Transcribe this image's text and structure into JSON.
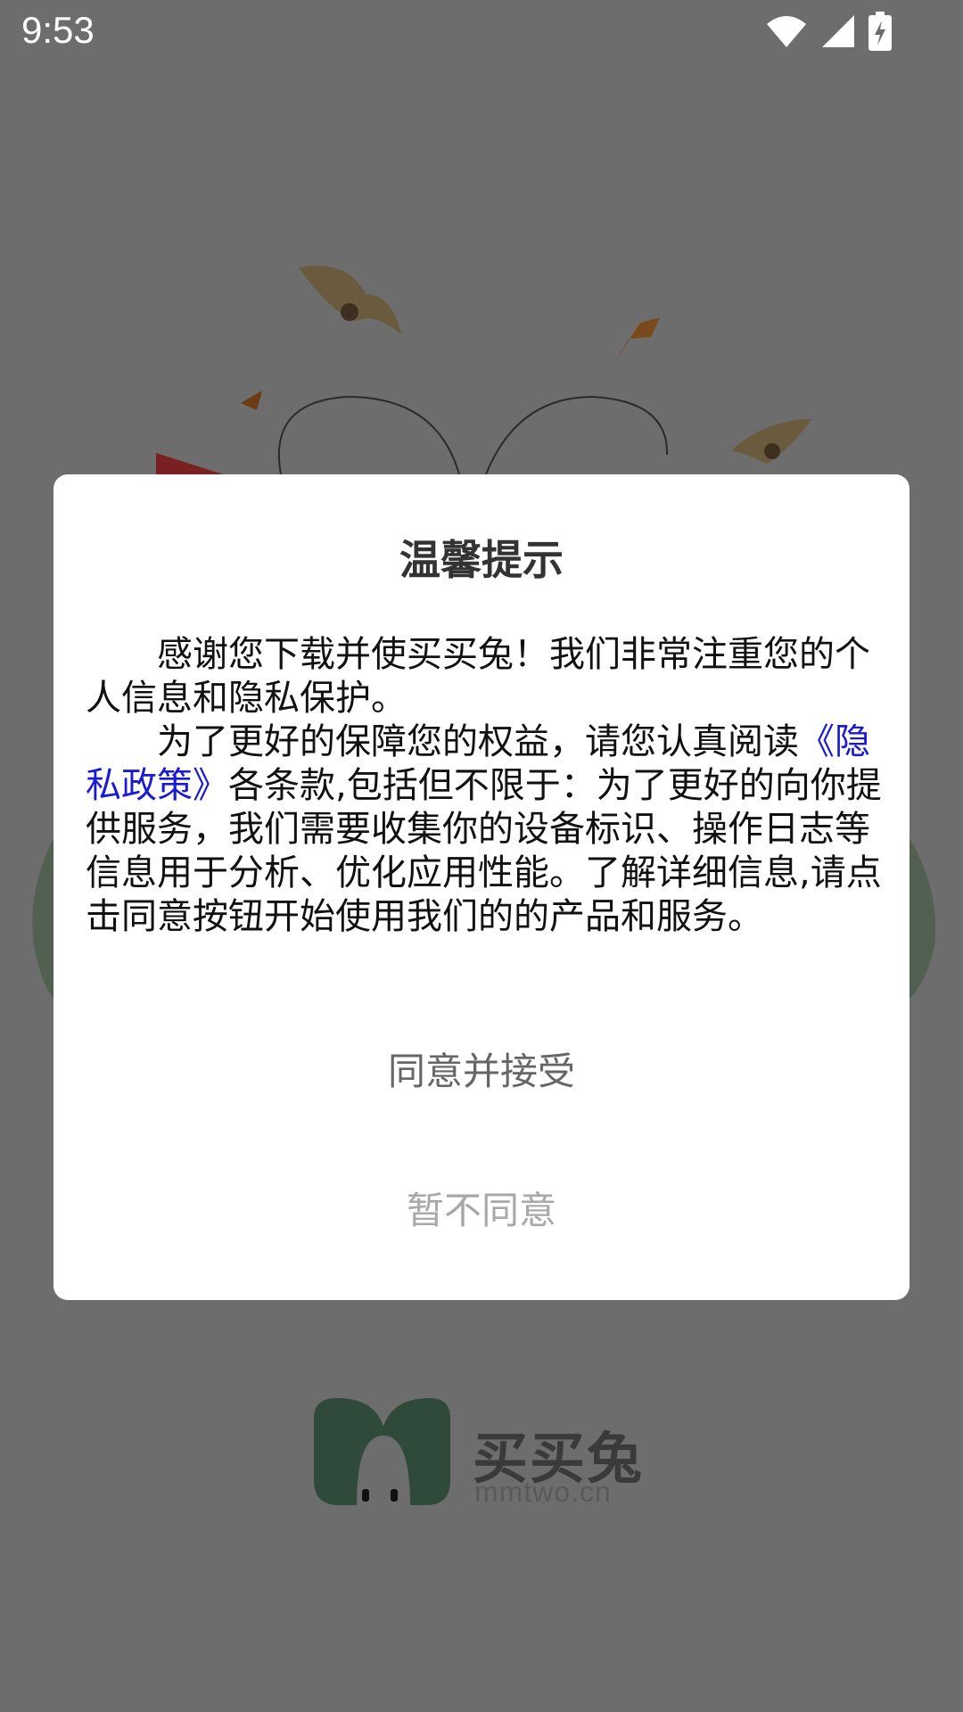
{
  "status_bar": {
    "time": "9:53",
    "icons": [
      "wifi-icon",
      "signal-icon",
      "battery-charging-icon"
    ]
  },
  "dialog": {
    "title": "温馨提示",
    "paragraph1": "感谢您下载并使买买兔！我们非常注重您的个人信息和隐私保护。",
    "paragraph2_prefix": "为了更好的保障您的权益，请您认真阅读",
    "policy_link": "《隐私政策》",
    "paragraph2_suffix": "各条款,包括但不限于：为了更好的向你提供服务，我们需要收集你的设备标识、操作日志等信息用于分析、优化应用性能。了解详细信息,请点击同意按钮开始使用我们的的产品和服务。",
    "agree_label": "同意并接受",
    "disagree_label": "暂不同意"
  },
  "logo": {
    "name": "买买兔",
    "domain": "mmtwo.cn"
  },
  "colors": {
    "overlay": "#6d6d6d",
    "dialog_bg": "#ffffff",
    "link": "#1a1ad1",
    "agree_text": "#666666",
    "disagree_text": "#a8a8a8",
    "logo_green": "#2f4a3a"
  }
}
